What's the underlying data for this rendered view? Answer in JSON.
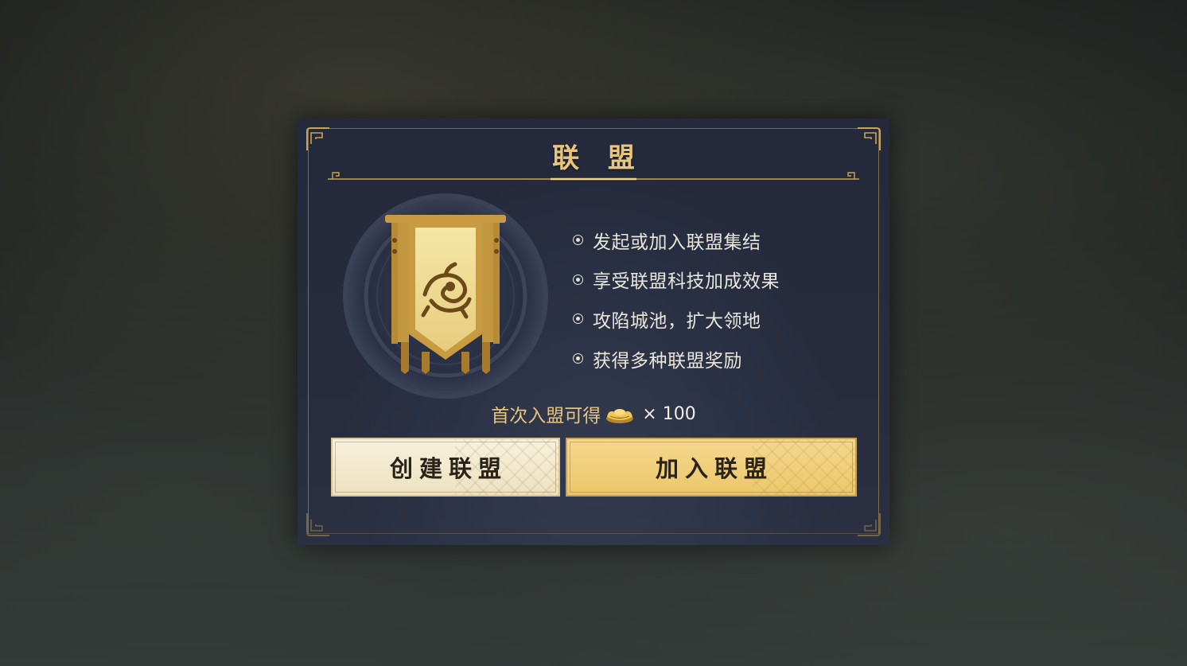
{
  "dialog": {
    "title": "联 盟",
    "features": [
      "发起或加入联盟集结",
      "享受联盟科技加成效果",
      "攻陷城池，扩大领地",
      "获得多种联盟奖励"
    ],
    "reward": {
      "label": "首次入盟可得",
      "icon": "gold-ingot-icon",
      "amount": "× 100"
    },
    "buttons": {
      "create_label": "创建联盟",
      "join_label": "加入联盟"
    }
  },
  "colors": {
    "accent_gold": "#e8c57a",
    "panel_bg": "#242a3c",
    "create_button_bg": "#f8f1dc",
    "join_button_bg": "#f5d88e"
  }
}
